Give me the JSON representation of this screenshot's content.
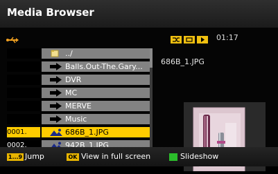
{
  "app": {
    "title": "Media Browser"
  },
  "status": {
    "time": "01:17"
  },
  "icons": {
    "usb": "usb-icon",
    "shuffle": "shuffle-icon",
    "repeat": "repeat-icon",
    "play": "play-icon",
    "folder": "folder-icon",
    "arrow": "right-arrow-icon",
    "image": "image-icon"
  },
  "list": {
    "items": [
      {
        "num": "",
        "label": "../",
        "type": "parent"
      },
      {
        "num": "",
        "label": "Balls.Out-The.Gary...",
        "type": "folder"
      },
      {
        "num": "",
        "label": "DVR",
        "type": "folder"
      },
      {
        "num": "",
        "label": "MC",
        "type": "folder"
      },
      {
        "num": "",
        "label": "MERVE",
        "type": "folder"
      },
      {
        "num": "",
        "label": "Music",
        "type": "folder"
      },
      {
        "num": "0001.",
        "label": "686B_1.JPG",
        "type": "image",
        "selected": true
      },
      {
        "num": "0002.",
        "label": "942B_1.JPG",
        "type": "image"
      }
    ]
  },
  "preview": {
    "filename": "686B_1.JPG"
  },
  "footer": {
    "jump_key": "1...9",
    "jump_label": "Jump",
    "ok_key": "OK",
    "ok_label": "View in full screen",
    "slideshow_label": "Slideshow"
  },
  "colors": {
    "highlight": "#ffcc00",
    "row_bg": "#828282",
    "green_key": "#2bbd2b",
    "yellow_key": "#e8b500"
  }
}
